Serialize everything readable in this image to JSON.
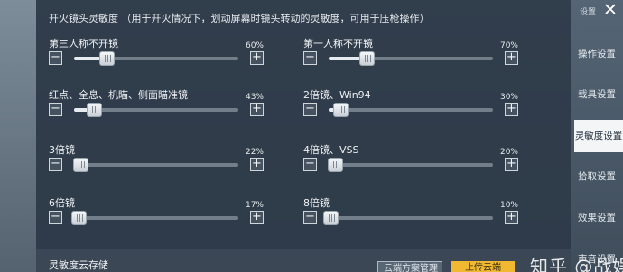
{
  "header": {
    "settings_tag": "设置",
    "section_title": "开火镜头灵敏度 （用于开火情况下，划动屏幕时镜头转动的灵敏度，可用于压枪操作）"
  },
  "sliders": [
    {
      "label": "第三人称不开镜",
      "percent": "60%",
      "value": 0.2
    },
    {
      "label": "第一人称不开镜",
      "percent": "70%",
      "value": 0.23
    },
    {
      "label": "红点、全息、机瞄、侧面瞄准镜",
      "percent": "43%",
      "value": 0.12
    },
    {
      "label": "2倍镜、Win94",
      "percent": "30%",
      "value": 0.07
    },
    {
      "label": "3倍镜",
      "percent": "22%",
      "value": 0.04
    },
    {
      "label": "4倍镜、VSS",
      "percent": "20%",
      "value": 0.04
    },
    {
      "label": "6倍镜",
      "percent": "17%",
      "value": 0.03
    },
    {
      "label": "8倍镜",
      "percent": "10%",
      "value": 0.01
    }
  ],
  "buttons": {
    "minus": "−",
    "plus": "+"
  },
  "cloud": {
    "title": "灵敏度云存储",
    "manage": "云端方案管理",
    "upload": "上传云端"
  },
  "tabs": [
    "操作设置",
    "载具设置",
    "灵敏度设置",
    "拾取设置",
    "效果设置",
    "声音设置"
  ],
  "active_tab": 2,
  "close": "✕",
  "watermark": "知乎 @战娱",
  "colors": {
    "accent": "#f0b931",
    "panel": "#2c3846",
    "active_tab_bg": "#f3f5f7"
  }
}
